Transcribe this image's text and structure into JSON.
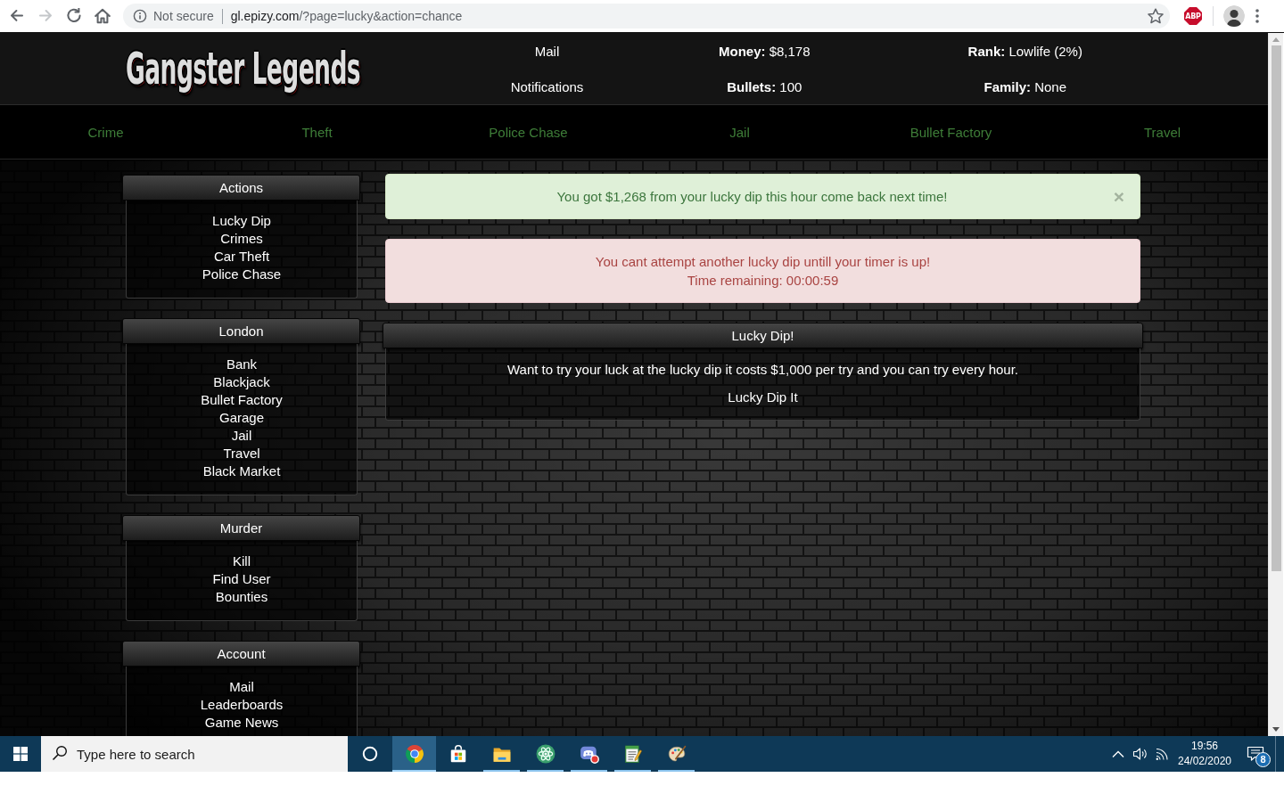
{
  "browser": {
    "nav_buttons": [
      {
        "kind": "back",
        "disabled": false
      },
      {
        "kind": "forward",
        "disabled": true
      },
      {
        "kind": "reload",
        "disabled": false
      },
      {
        "kind": "home",
        "disabled": false
      }
    ],
    "security_label": "Not secure",
    "url": {
      "host": "gl.epizy.com",
      "path": "/?page=lucky&action=chance"
    },
    "bookmarked": false,
    "extension": "ABP"
  },
  "header": {
    "logo": "Gangster Legends",
    "links": [
      "Mail",
      "Notifications"
    ],
    "stats": [
      "**Money:** $8,178",
      "**Rank:** Lowlife (2%)",
      "**Bullets:** 100",
      "**Family:** None"
    ]
  },
  "nav": [
    "Crime",
    "Theft",
    "Police Chase",
    "Jail",
    "Bullet Factory",
    "Travel"
  ],
  "sidebar": [
    {
      "title": "Actions",
      "items": [
        "Lucky Dip",
        "Crimes",
        "Car Theft",
        "Police Chase"
      ]
    },
    {
      "title": "London",
      "items": [
        "Bank",
        "Blackjack",
        "Bullet Factory",
        "Garage",
        "Jail",
        "Travel",
        "Black Market"
      ]
    },
    {
      "title": "Murder",
      "items": [
        "Kill",
        "Find User",
        "Bounties"
      ]
    },
    {
      "title": "Account",
      "items": [
        "Mail",
        "Leaderboards",
        "Game News"
      ]
    }
  ],
  "alerts": [
    {
      "kind": "success",
      "lines": [
        "You got $1,268 from your lucky dip this hour come back next time!"
      ],
      "close": "×"
    },
    {
      "kind": "danger",
      "lines": [
        "You cant attempt another lucky dip untill your timer is up!",
        "Time remaining: 00:00:59"
      ]
    }
  ],
  "panel": {
    "title": "Lucky Dip!",
    "text": "Want to try your luck at the lucky dip it costs $1,000 per try and you can try every hour.",
    "action": "Lucky Dip It"
  },
  "taskbar": {
    "search_placeholder": "Type here to search",
    "apps": [
      {
        "kind": "browser",
        "running": true,
        "selected": true
      },
      {
        "kind": "store",
        "running": false,
        "selected": false
      },
      {
        "kind": "files",
        "running": true,
        "selected": false
      },
      {
        "kind": "atom",
        "running": true,
        "selected": false
      },
      {
        "kind": "chat",
        "running": true,
        "selected": false
      },
      {
        "kind": "notes",
        "running": true,
        "selected": false
      },
      {
        "kind": "paint",
        "running": true,
        "selected": false
      }
    ],
    "tray": {
      "time": "19:56",
      "date": "24/02/2020",
      "notification_count": "8"
    }
  }
}
